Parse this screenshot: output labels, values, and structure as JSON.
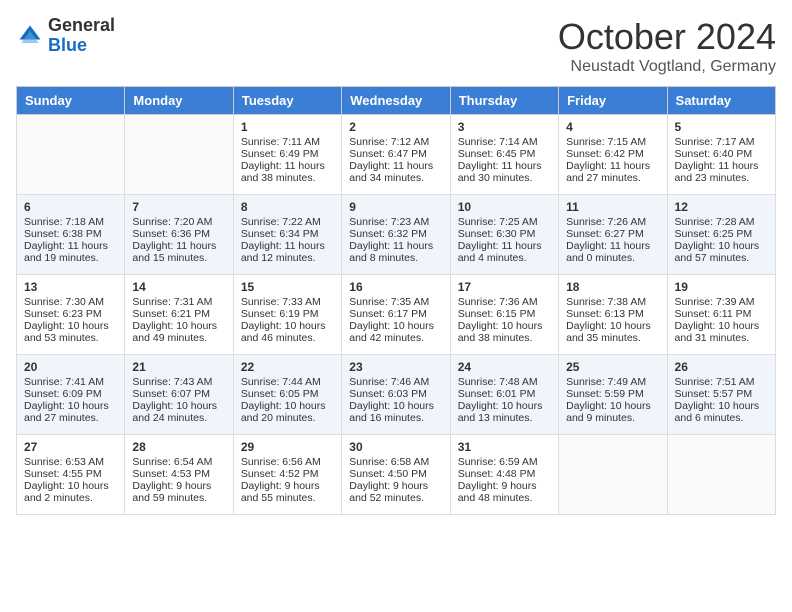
{
  "header": {
    "logo_general": "General",
    "logo_blue": "Blue",
    "month_title": "October 2024",
    "location": "Neustadt Vogtland, Germany"
  },
  "days_of_week": [
    "Sunday",
    "Monday",
    "Tuesday",
    "Wednesday",
    "Thursday",
    "Friday",
    "Saturday"
  ],
  "weeks": [
    [
      {
        "day": "",
        "sunrise": "",
        "sunset": "",
        "daylight": ""
      },
      {
        "day": "",
        "sunrise": "",
        "sunset": "",
        "daylight": ""
      },
      {
        "day": "1",
        "sunrise": "Sunrise: 7:11 AM",
        "sunset": "Sunset: 6:49 PM",
        "daylight": "Daylight: 11 hours and 38 minutes."
      },
      {
        "day": "2",
        "sunrise": "Sunrise: 7:12 AM",
        "sunset": "Sunset: 6:47 PM",
        "daylight": "Daylight: 11 hours and 34 minutes."
      },
      {
        "day": "3",
        "sunrise": "Sunrise: 7:14 AM",
        "sunset": "Sunset: 6:45 PM",
        "daylight": "Daylight: 11 hours and 30 minutes."
      },
      {
        "day": "4",
        "sunrise": "Sunrise: 7:15 AM",
        "sunset": "Sunset: 6:42 PM",
        "daylight": "Daylight: 11 hours and 27 minutes."
      },
      {
        "day": "5",
        "sunrise": "Sunrise: 7:17 AM",
        "sunset": "Sunset: 6:40 PM",
        "daylight": "Daylight: 11 hours and 23 minutes."
      }
    ],
    [
      {
        "day": "6",
        "sunrise": "Sunrise: 7:18 AM",
        "sunset": "Sunset: 6:38 PM",
        "daylight": "Daylight: 11 hours and 19 minutes."
      },
      {
        "day": "7",
        "sunrise": "Sunrise: 7:20 AM",
        "sunset": "Sunset: 6:36 PM",
        "daylight": "Daylight: 11 hours and 15 minutes."
      },
      {
        "day": "8",
        "sunrise": "Sunrise: 7:22 AM",
        "sunset": "Sunset: 6:34 PM",
        "daylight": "Daylight: 11 hours and 12 minutes."
      },
      {
        "day": "9",
        "sunrise": "Sunrise: 7:23 AM",
        "sunset": "Sunset: 6:32 PM",
        "daylight": "Daylight: 11 hours and 8 minutes."
      },
      {
        "day": "10",
        "sunrise": "Sunrise: 7:25 AM",
        "sunset": "Sunset: 6:30 PM",
        "daylight": "Daylight: 11 hours and 4 minutes."
      },
      {
        "day": "11",
        "sunrise": "Sunrise: 7:26 AM",
        "sunset": "Sunset: 6:27 PM",
        "daylight": "Daylight: 11 hours and 0 minutes."
      },
      {
        "day": "12",
        "sunrise": "Sunrise: 7:28 AM",
        "sunset": "Sunset: 6:25 PM",
        "daylight": "Daylight: 10 hours and 57 minutes."
      }
    ],
    [
      {
        "day": "13",
        "sunrise": "Sunrise: 7:30 AM",
        "sunset": "Sunset: 6:23 PM",
        "daylight": "Daylight: 10 hours and 53 minutes."
      },
      {
        "day": "14",
        "sunrise": "Sunrise: 7:31 AM",
        "sunset": "Sunset: 6:21 PM",
        "daylight": "Daylight: 10 hours and 49 minutes."
      },
      {
        "day": "15",
        "sunrise": "Sunrise: 7:33 AM",
        "sunset": "Sunset: 6:19 PM",
        "daylight": "Daylight: 10 hours and 46 minutes."
      },
      {
        "day": "16",
        "sunrise": "Sunrise: 7:35 AM",
        "sunset": "Sunset: 6:17 PM",
        "daylight": "Daylight: 10 hours and 42 minutes."
      },
      {
        "day": "17",
        "sunrise": "Sunrise: 7:36 AM",
        "sunset": "Sunset: 6:15 PM",
        "daylight": "Daylight: 10 hours and 38 minutes."
      },
      {
        "day": "18",
        "sunrise": "Sunrise: 7:38 AM",
        "sunset": "Sunset: 6:13 PM",
        "daylight": "Daylight: 10 hours and 35 minutes."
      },
      {
        "day": "19",
        "sunrise": "Sunrise: 7:39 AM",
        "sunset": "Sunset: 6:11 PM",
        "daylight": "Daylight: 10 hours and 31 minutes."
      }
    ],
    [
      {
        "day": "20",
        "sunrise": "Sunrise: 7:41 AM",
        "sunset": "Sunset: 6:09 PM",
        "daylight": "Daylight: 10 hours and 27 minutes."
      },
      {
        "day": "21",
        "sunrise": "Sunrise: 7:43 AM",
        "sunset": "Sunset: 6:07 PM",
        "daylight": "Daylight: 10 hours and 24 minutes."
      },
      {
        "day": "22",
        "sunrise": "Sunrise: 7:44 AM",
        "sunset": "Sunset: 6:05 PM",
        "daylight": "Daylight: 10 hours and 20 minutes."
      },
      {
        "day": "23",
        "sunrise": "Sunrise: 7:46 AM",
        "sunset": "Sunset: 6:03 PM",
        "daylight": "Daylight: 10 hours and 16 minutes."
      },
      {
        "day": "24",
        "sunrise": "Sunrise: 7:48 AM",
        "sunset": "Sunset: 6:01 PM",
        "daylight": "Daylight: 10 hours and 13 minutes."
      },
      {
        "day": "25",
        "sunrise": "Sunrise: 7:49 AM",
        "sunset": "Sunset: 5:59 PM",
        "daylight": "Daylight: 10 hours and 9 minutes."
      },
      {
        "day": "26",
        "sunrise": "Sunrise: 7:51 AM",
        "sunset": "Sunset: 5:57 PM",
        "daylight": "Daylight: 10 hours and 6 minutes."
      }
    ],
    [
      {
        "day": "27",
        "sunrise": "Sunrise: 6:53 AM",
        "sunset": "Sunset: 4:55 PM",
        "daylight": "Daylight: 10 hours and 2 minutes."
      },
      {
        "day": "28",
        "sunrise": "Sunrise: 6:54 AM",
        "sunset": "Sunset: 4:53 PM",
        "daylight": "Daylight: 9 hours and 59 minutes."
      },
      {
        "day": "29",
        "sunrise": "Sunrise: 6:56 AM",
        "sunset": "Sunset: 4:52 PM",
        "daylight": "Daylight: 9 hours and 55 minutes."
      },
      {
        "day": "30",
        "sunrise": "Sunrise: 6:58 AM",
        "sunset": "Sunset: 4:50 PM",
        "daylight": "Daylight: 9 hours and 52 minutes."
      },
      {
        "day": "31",
        "sunrise": "Sunrise: 6:59 AM",
        "sunset": "Sunset: 4:48 PM",
        "daylight": "Daylight: 9 hours and 48 minutes."
      },
      {
        "day": "",
        "sunrise": "",
        "sunset": "",
        "daylight": ""
      },
      {
        "day": "",
        "sunrise": "",
        "sunset": "",
        "daylight": ""
      }
    ]
  ]
}
